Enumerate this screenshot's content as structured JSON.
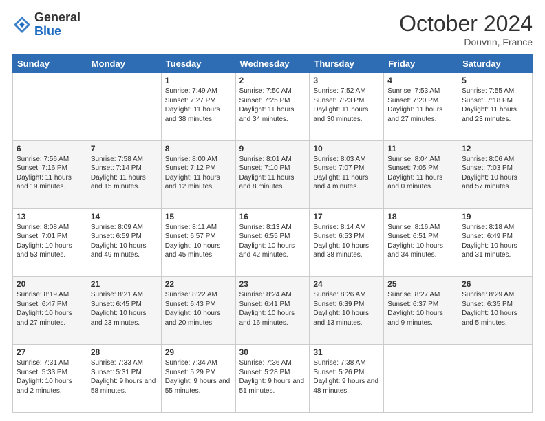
{
  "header": {
    "logo_general": "General",
    "logo_blue": "Blue",
    "month": "October 2024",
    "location": "Douvrin, France"
  },
  "days_of_week": [
    "Sunday",
    "Monday",
    "Tuesday",
    "Wednesday",
    "Thursday",
    "Friday",
    "Saturday"
  ],
  "weeks": [
    [
      {
        "day": "",
        "sunrise": "",
        "sunset": "",
        "daylight": "",
        "empty": true
      },
      {
        "day": "",
        "sunrise": "",
        "sunset": "",
        "daylight": "",
        "empty": true
      },
      {
        "day": "1",
        "sunrise": "Sunrise: 7:49 AM",
        "sunset": "Sunset: 7:27 PM",
        "daylight": "Daylight: 11 hours and 38 minutes.",
        "empty": false
      },
      {
        "day": "2",
        "sunrise": "Sunrise: 7:50 AM",
        "sunset": "Sunset: 7:25 PM",
        "daylight": "Daylight: 11 hours and 34 minutes.",
        "empty": false
      },
      {
        "day": "3",
        "sunrise": "Sunrise: 7:52 AM",
        "sunset": "Sunset: 7:23 PM",
        "daylight": "Daylight: 11 hours and 30 minutes.",
        "empty": false
      },
      {
        "day": "4",
        "sunrise": "Sunrise: 7:53 AM",
        "sunset": "Sunset: 7:20 PM",
        "daylight": "Daylight: 11 hours and 27 minutes.",
        "empty": false
      },
      {
        "day": "5",
        "sunrise": "Sunrise: 7:55 AM",
        "sunset": "Sunset: 7:18 PM",
        "daylight": "Daylight: 11 hours and 23 minutes.",
        "empty": false
      }
    ],
    [
      {
        "day": "6",
        "sunrise": "Sunrise: 7:56 AM",
        "sunset": "Sunset: 7:16 PM",
        "daylight": "Daylight: 11 hours and 19 minutes.",
        "empty": false
      },
      {
        "day": "7",
        "sunrise": "Sunrise: 7:58 AM",
        "sunset": "Sunset: 7:14 PM",
        "daylight": "Daylight: 11 hours and 15 minutes.",
        "empty": false
      },
      {
        "day": "8",
        "sunrise": "Sunrise: 8:00 AM",
        "sunset": "Sunset: 7:12 PM",
        "daylight": "Daylight: 11 hours and 12 minutes.",
        "empty": false
      },
      {
        "day": "9",
        "sunrise": "Sunrise: 8:01 AM",
        "sunset": "Sunset: 7:10 PM",
        "daylight": "Daylight: 11 hours and 8 minutes.",
        "empty": false
      },
      {
        "day": "10",
        "sunrise": "Sunrise: 8:03 AM",
        "sunset": "Sunset: 7:07 PM",
        "daylight": "Daylight: 11 hours and 4 minutes.",
        "empty": false
      },
      {
        "day": "11",
        "sunrise": "Sunrise: 8:04 AM",
        "sunset": "Sunset: 7:05 PM",
        "daylight": "Daylight: 11 hours and 0 minutes.",
        "empty": false
      },
      {
        "day": "12",
        "sunrise": "Sunrise: 8:06 AM",
        "sunset": "Sunset: 7:03 PM",
        "daylight": "Daylight: 10 hours and 57 minutes.",
        "empty": false
      }
    ],
    [
      {
        "day": "13",
        "sunrise": "Sunrise: 8:08 AM",
        "sunset": "Sunset: 7:01 PM",
        "daylight": "Daylight: 10 hours and 53 minutes.",
        "empty": false
      },
      {
        "day": "14",
        "sunrise": "Sunrise: 8:09 AM",
        "sunset": "Sunset: 6:59 PM",
        "daylight": "Daylight: 10 hours and 49 minutes.",
        "empty": false
      },
      {
        "day": "15",
        "sunrise": "Sunrise: 8:11 AM",
        "sunset": "Sunset: 6:57 PM",
        "daylight": "Daylight: 10 hours and 45 minutes.",
        "empty": false
      },
      {
        "day": "16",
        "sunrise": "Sunrise: 8:13 AM",
        "sunset": "Sunset: 6:55 PM",
        "daylight": "Daylight: 10 hours and 42 minutes.",
        "empty": false
      },
      {
        "day": "17",
        "sunrise": "Sunrise: 8:14 AM",
        "sunset": "Sunset: 6:53 PM",
        "daylight": "Daylight: 10 hours and 38 minutes.",
        "empty": false
      },
      {
        "day": "18",
        "sunrise": "Sunrise: 8:16 AM",
        "sunset": "Sunset: 6:51 PM",
        "daylight": "Daylight: 10 hours and 34 minutes.",
        "empty": false
      },
      {
        "day": "19",
        "sunrise": "Sunrise: 8:18 AM",
        "sunset": "Sunset: 6:49 PM",
        "daylight": "Daylight: 10 hours and 31 minutes.",
        "empty": false
      }
    ],
    [
      {
        "day": "20",
        "sunrise": "Sunrise: 8:19 AM",
        "sunset": "Sunset: 6:47 PM",
        "daylight": "Daylight: 10 hours and 27 minutes.",
        "empty": false
      },
      {
        "day": "21",
        "sunrise": "Sunrise: 8:21 AM",
        "sunset": "Sunset: 6:45 PM",
        "daylight": "Daylight: 10 hours and 23 minutes.",
        "empty": false
      },
      {
        "day": "22",
        "sunrise": "Sunrise: 8:22 AM",
        "sunset": "Sunset: 6:43 PM",
        "daylight": "Daylight: 10 hours and 20 minutes.",
        "empty": false
      },
      {
        "day": "23",
        "sunrise": "Sunrise: 8:24 AM",
        "sunset": "Sunset: 6:41 PM",
        "daylight": "Daylight: 10 hours and 16 minutes.",
        "empty": false
      },
      {
        "day": "24",
        "sunrise": "Sunrise: 8:26 AM",
        "sunset": "Sunset: 6:39 PM",
        "daylight": "Daylight: 10 hours and 13 minutes.",
        "empty": false
      },
      {
        "day": "25",
        "sunrise": "Sunrise: 8:27 AM",
        "sunset": "Sunset: 6:37 PM",
        "daylight": "Daylight: 10 hours and 9 minutes.",
        "empty": false
      },
      {
        "day": "26",
        "sunrise": "Sunrise: 8:29 AM",
        "sunset": "Sunset: 6:35 PM",
        "daylight": "Daylight: 10 hours and 5 minutes.",
        "empty": false
      }
    ],
    [
      {
        "day": "27",
        "sunrise": "Sunrise: 7:31 AM",
        "sunset": "Sunset: 5:33 PM",
        "daylight": "Daylight: 10 hours and 2 minutes.",
        "empty": false
      },
      {
        "day": "28",
        "sunrise": "Sunrise: 7:33 AM",
        "sunset": "Sunset: 5:31 PM",
        "daylight": "Daylight: 9 hours and 58 minutes.",
        "empty": false
      },
      {
        "day": "29",
        "sunrise": "Sunrise: 7:34 AM",
        "sunset": "Sunset: 5:29 PM",
        "daylight": "Daylight: 9 hours and 55 minutes.",
        "empty": false
      },
      {
        "day": "30",
        "sunrise": "Sunrise: 7:36 AM",
        "sunset": "Sunset: 5:28 PM",
        "daylight": "Daylight: 9 hours and 51 minutes.",
        "empty": false
      },
      {
        "day": "31",
        "sunrise": "Sunrise: 7:38 AM",
        "sunset": "Sunset: 5:26 PM",
        "daylight": "Daylight: 9 hours and 48 minutes.",
        "empty": false
      },
      {
        "day": "",
        "sunrise": "",
        "sunset": "",
        "daylight": "",
        "empty": true
      },
      {
        "day": "",
        "sunrise": "",
        "sunset": "",
        "daylight": "",
        "empty": true
      }
    ]
  ]
}
